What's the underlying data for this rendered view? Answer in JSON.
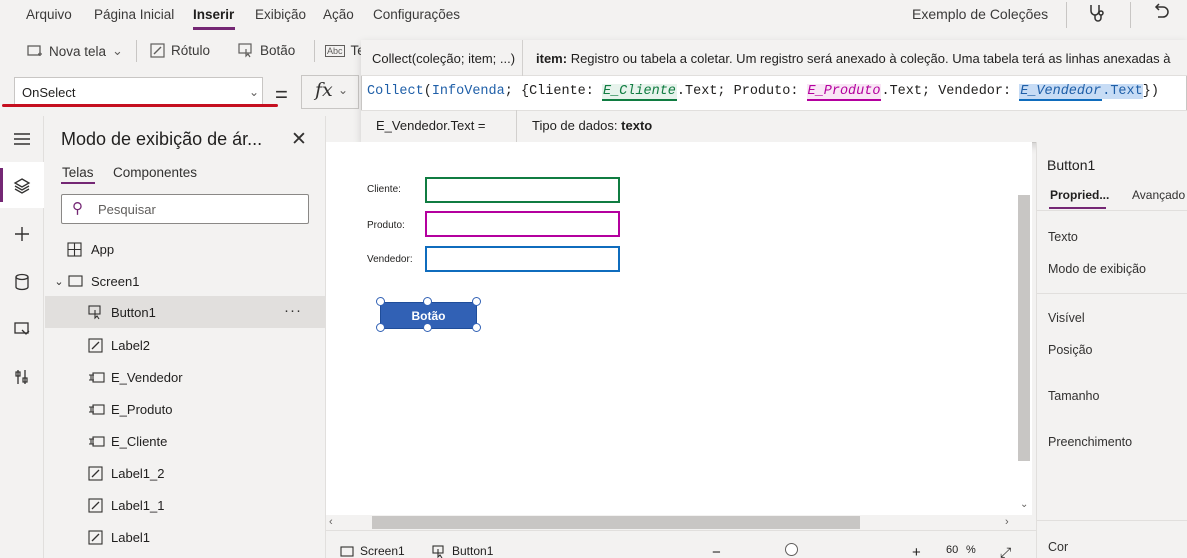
{
  "menu": {
    "items": [
      "Arquivo",
      "Página Inicial",
      "Inserir",
      "Exibição",
      "Ação",
      "Configurações"
    ],
    "active": "Inserir",
    "app_title": "Exemplo de Coleções"
  },
  "toolbar": {
    "new_screen": "Nova tela",
    "label": "Rótulo",
    "button": "Botão",
    "text_partial": "Te"
  },
  "formula_bar": {
    "property": "OnSelect",
    "equals": "=",
    "fx": "fx",
    "signature": "Collect(coleção; item; ...)",
    "hint_param": "item:",
    "hint_text": "Registro ou tabela a coletar. Um registro será anexado à coleção. Uma tabela terá as linhas anexadas à",
    "formula": {
      "fn": "Collect",
      "collection": "InfoVenda",
      "field1": "Cliente",
      "ctrl1": "E_Cliente",
      "field2": "Produto",
      "ctrl2": "E_Produto",
      "field3": "Vendedor",
      "ctrl3": "E_Vendedor",
      "prop": "Text"
    },
    "result_expr": "E_Vendedor.Text  =",
    "result_type_label": "Tipo de dados:",
    "result_type": "texto"
  },
  "tree": {
    "title": "Modo de exibição de ár...",
    "tabs": [
      "Telas",
      "Componentes"
    ],
    "search_placeholder": "Pesquisar",
    "nodes": [
      "App",
      "Screen1",
      "Button1",
      "Label2",
      "E_Vendedor",
      "E_Produto",
      "E_Cliente",
      "Label1_2",
      "Label1_1",
      "Label1"
    ],
    "selected": "Button1",
    "more": "···"
  },
  "canvas": {
    "label_cliente": "Cliente:",
    "label_produto": "Produto:",
    "label_vendedor": "Vendedor:",
    "button_text": "Botão",
    "input_colors": {
      "cliente": "#107c41",
      "produto": "#b4009e",
      "vendedor": "#0f6cbd"
    }
  },
  "status": {
    "screen": "Screen1",
    "control": "Button1",
    "zoom": "60",
    "zoom_unit": "%"
  },
  "properties": {
    "control_name": "Button1",
    "tabs": [
      "Propried...",
      "Avançado"
    ],
    "labels": [
      "Texto",
      "Modo de exibição",
      "Visível",
      "Posição",
      "Tamanho",
      "Preenchimento",
      "Cor"
    ]
  },
  "colors": {
    "accent": "#742774",
    "button": "#3161b5",
    "error_underline": "#c50f1f"
  }
}
